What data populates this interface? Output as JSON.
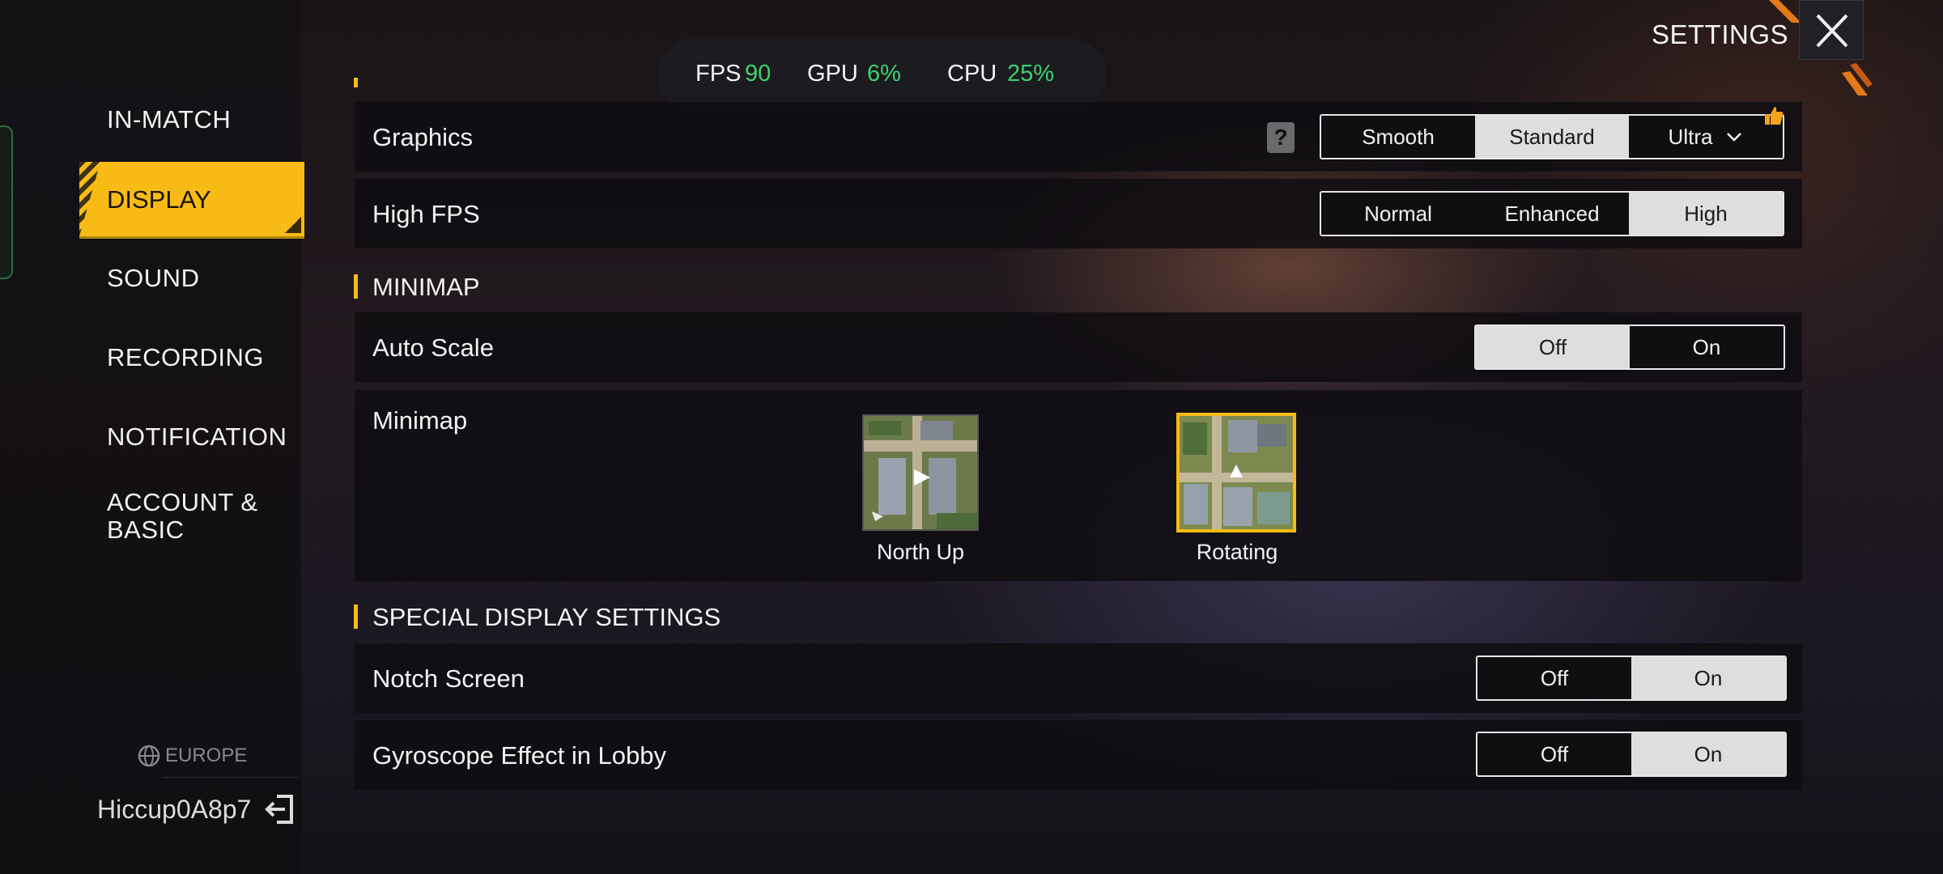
{
  "header": {
    "title": "SETTINGS",
    "close_icon": "close-icon"
  },
  "perf": {
    "fps_label": "FPS",
    "fps_value": "90",
    "gpu_label": "GPU",
    "gpu_value": "6%",
    "cpu_label": "CPU",
    "cpu_value": "25%"
  },
  "sidebar": {
    "items": [
      {
        "label": "IN-MATCH"
      },
      {
        "label": "DISPLAY",
        "active": true
      },
      {
        "label": "SOUND"
      },
      {
        "label": "RECORDING"
      },
      {
        "label": "NOTIFICATION"
      },
      {
        "label": "ACCOUNT &"
      },
      {
        "label": "BASIC"
      }
    ],
    "region": "EUROPE",
    "username": "Hiccup0A8p7"
  },
  "display": {
    "graphics": {
      "label": "Graphics",
      "options": [
        "Smooth",
        "Standard",
        "Ultra"
      ],
      "selected": "Standard"
    },
    "high_fps": {
      "label": "High FPS",
      "options": [
        "Normal",
        "Enhanced",
        "High"
      ],
      "selected": "High"
    }
  },
  "minimap_section": {
    "title": "MINIMAP",
    "auto_scale": {
      "label": "Auto Scale",
      "options": [
        "Off",
        "On"
      ],
      "selected": "Off"
    },
    "minimap": {
      "label": "Minimap",
      "options": [
        "North Up",
        "Rotating"
      ],
      "selected": "Rotating"
    }
  },
  "special_section": {
    "title": "SPECIAL DISPLAY SETTINGS",
    "notch_screen": {
      "label": "Notch Screen",
      "options": [
        "Off",
        "On"
      ],
      "selected": "On"
    },
    "gyroscope": {
      "label": "Gyroscope Effect in Lobby",
      "options": [
        "Off",
        "On"
      ],
      "selected": "On"
    }
  },
  "colors": {
    "accent": "#f8bb15",
    "perf_value": "#3dd26b",
    "selected_option_bg": "#dedede"
  }
}
